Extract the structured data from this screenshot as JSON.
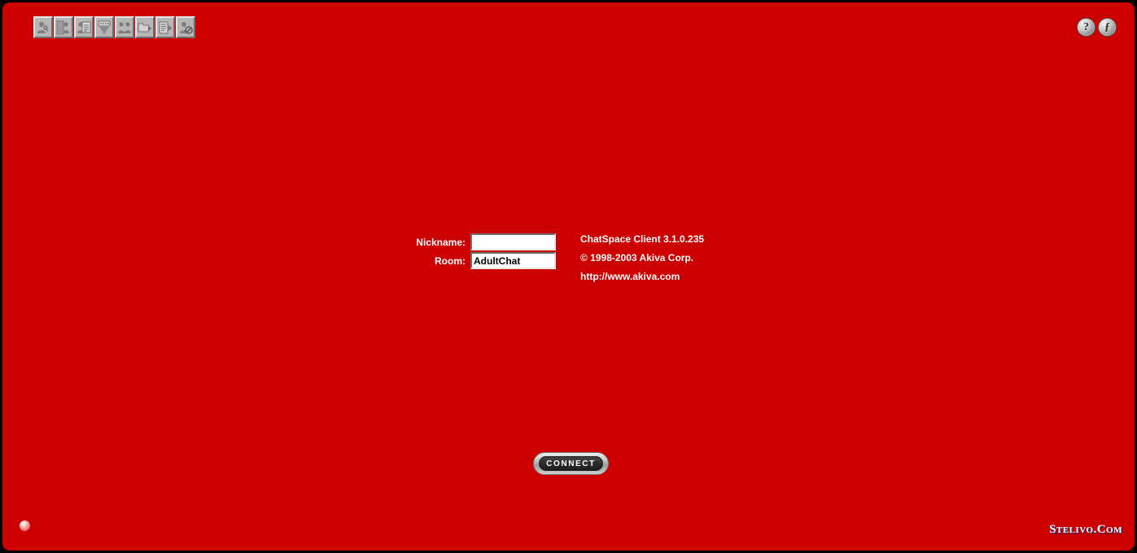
{
  "window": {
    "background_color": "#CC0000",
    "border_color": "#000000"
  },
  "toolbar": {
    "buttons": [
      {
        "name": "user-profile-icon",
        "tooltip": "Profile"
      },
      {
        "name": "people-list-icon",
        "tooltip": "Member List"
      },
      {
        "name": "notes-list-icon",
        "tooltip": "Notes"
      },
      {
        "name": "chat-bubble-icon",
        "tooltip": "Chat"
      },
      {
        "name": "group-people-icon",
        "tooltip": "Groups"
      },
      {
        "name": "folder-arrow-icon",
        "tooltip": "Rooms"
      },
      {
        "name": "document-arrow-icon",
        "tooltip": "Logs"
      },
      {
        "name": "user-block-icon",
        "tooltip": "Ignore List"
      }
    ]
  },
  "corner_buttons": [
    {
      "name": "help-button",
      "glyph": "?"
    },
    {
      "name": "tools-button",
      "glyph": "ƒ"
    }
  ],
  "form": {
    "nickname": {
      "label": "Nickname:",
      "value": "",
      "placeholder": ""
    },
    "room": {
      "label": "Room:",
      "value": "AdultChat",
      "placeholder": ""
    }
  },
  "about": {
    "client": "ChatSpace Client 3.1.0.235",
    "copyright": "© 1998-2003 Akiva Corp.",
    "website": "http://www.akiva.com"
  },
  "connect": {
    "label": "CONNECT"
  },
  "watermark": {
    "text": "Stelivo.Com"
  }
}
